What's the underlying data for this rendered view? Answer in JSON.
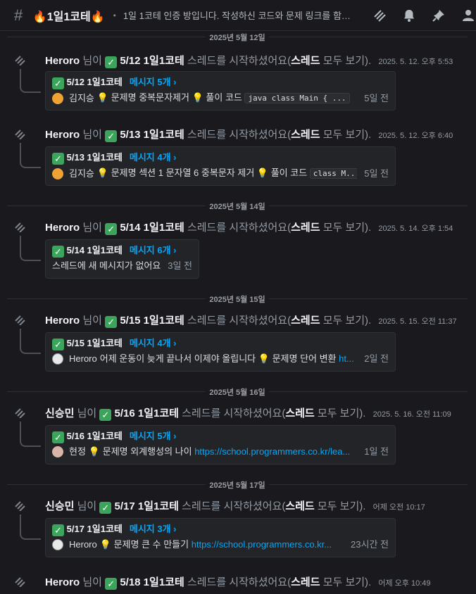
{
  "header": {
    "channel_name": "🔥1일1코테🔥",
    "topic": "1일 1코테 인증 방입니다. 작성하신 코드와 문제 링크를 함께 공유...",
    "icons": [
      "hash-icon",
      "threads-icon",
      "bell-icon",
      "pin-icon",
      "members-icon"
    ]
  },
  "dividers": [
    "2025년 5월 12일",
    "2025년 5월 14일",
    "2025년 5월 15일",
    "2025년 5월 16일",
    "2025년 5월 17일"
  ],
  "common": {
    "suffix_nim": "님이",
    "started": "스레드를 시작하셨어요(",
    "thread_word": "스레드",
    "view_all": "모두 보기)."
  },
  "messages": [
    {
      "author": "Heroro",
      "title": "5/12 1일1코테",
      "timestamp": "2025. 5. 12. 오후 5:53",
      "card_title": "5/12 1일1코테",
      "count": "메시지 5개 ›",
      "preview_user": "김지승",
      "preview_parts": [
        "문제명 중복문자제거",
        "풀이 코드"
      ],
      "preview_code": "java  class Main {  ...",
      "ago": "5일 전"
    },
    {
      "author": "Heroro",
      "title": "5/13 1일1코테",
      "timestamp": "2025. 5. 12. 오후 6:40",
      "card_title": "5/13 1일1코테",
      "count": "메시지 4개 ›",
      "preview_user": "김지승",
      "preview_parts": [
        "문제명 섹션 1 문자열 6 중복문자 제거",
        "풀이 코드"
      ],
      "preview_code": "class M...",
      "ago": "5일 전"
    },
    {
      "author": "Heroro",
      "title": "5/14 1일1코테",
      "timestamp": "2025. 5. 14. 오후 1:54",
      "card_title": "5/14 1일1코테",
      "count": "메시지 6개 ›",
      "empty_text": "스레드에 새 메시지가 없어요.",
      "ago": "3일 전"
    },
    {
      "author": "Heroro",
      "title": "5/15 1일1코테",
      "timestamp": "2025. 5. 15. 오전 11:37",
      "card_title": "5/15 1일1코테",
      "count": "메시지 4개 ›",
      "preview_user": "Heroro",
      "preview_parts": [
        "어제 운동이 늦게 끝나서 이제야 올립니다",
        "문제명 단어 변환"
      ],
      "preview_link": "ht...",
      "ago": "2일 전"
    },
    {
      "author": "신승민",
      "title": "5/16 1일1코테",
      "timestamp": "2025. 5. 16. 오전 11:09",
      "card_title": "5/16 1일1코테",
      "count": "메시지 5개 ›",
      "preview_user": "현정",
      "preview_parts": [
        "문제명 외계행성의 나이"
      ],
      "preview_link": "https://school.programmers.co.kr/lea...",
      "ago": "1일 전"
    },
    {
      "author": "신승민",
      "title": "5/17 1일1코테",
      "timestamp": "어제 오전 10:17",
      "card_title": "5/17 1일1코테",
      "count": "메시지 3개 ›",
      "preview_user": "Heroro",
      "preview_parts": [
        "문제명 큰 수 만들기"
      ],
      "preview_link": "https://school.programmers.co.kr...",
      "ago": "23시간 전"
    },
    {
      "author": "Heroro",
      "title": "5/18 1일1코테",
      "timestamp": "어제 오후 10:49"
    }
  ]
}
